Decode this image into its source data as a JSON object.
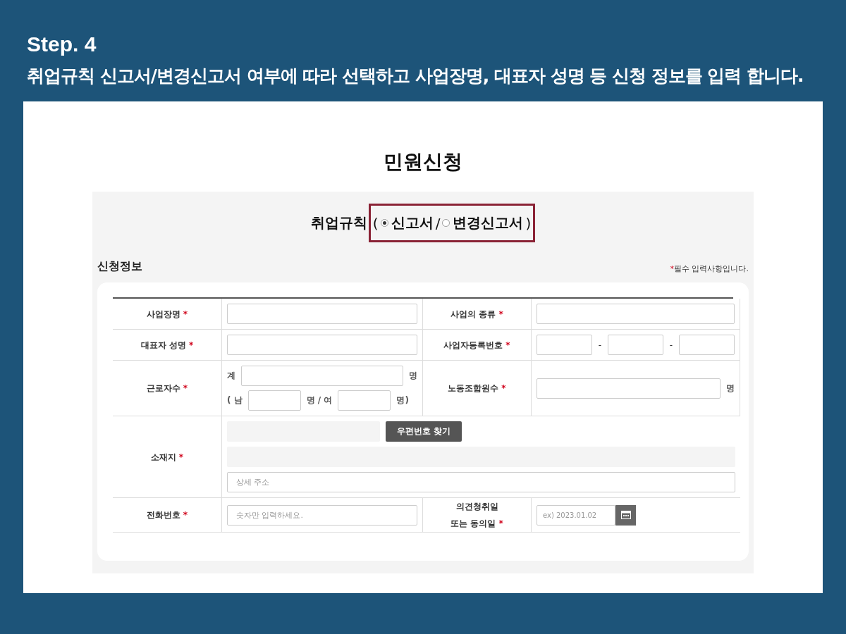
{
  "step": {
    "label": "Step. 4",
    "instruction": "취업규칙 신고서/변경신고서 여부에 따라 선택하고 사업장명, 대표자 성명 등 신청 정보를 입력 합니다."
  },
  "page_title": "민원신청",
  "rule_type": {
    "label": "취업규칙",
    "open": "(",
    "separator": "/",
    "close": ")",
    "options": [
      {
        "label": "신고서",
        "selected": true
      },
      {
        "label": "변경신고서",
        "selected": false
      }
    ]
  },
  "section": {
    "title": "신청정보",
    "note_mark": "*",
    "note": "필수 입력사항입니다."
  },
  "rows": [
    {
      "cells": [
        {
          "kind": "text",
          "label": [
            "사업장명"
          ],
          "required_mark": "*"
        },
        {
          "kind": "text",
          "label": [
            "사업의 종류"
          ],
          "required_mark": "*"
        }
      ]
    },
    {
      "cells": [
        {
          "kind": "text",
          "label": [
            "대표자 성명"
          ],
          "required_mark": "*"
        },
        {
          "kind": "split",
          "label": [
            "사업자등록번호"
          ],
          "required_mark": "*",
          "separators": [
            "-",
            "-"
          ]
        }
      ]
    },
    {
      "cells": [
        {
          "kind": "workers",
          "label": [
            "근로자수"
          ],
          "required_mark": "*",
          "total_prefix": "계",
          "total_unit": "명",
          "male_prefix": "( 남",
          "male_unit": "명 / 여",
          "female_unit": "명)"
        },
        {
          "kind": "unit",
          "label": [
            "노동조합원수"
          ],
          "required_mark": "*",
          "unit": "명"
        }
      ]
    },
    {
      "cells": [
        {
          "kind": "address",
          "label": [
            "소재지"
          ],
          "required_mark": "*",
          "button": "우편번호 찾기",
          "placeholder": "상세 주소"
        }
      ]
    },
    {
      "cells": [
        {
          "kind": "text",
          "label": [
            "전화번호"
          ],
          "required_mark": "*",
          "placeholder": "숫자만 입력하세요."
        },
        {
          "kind": "date",
          "label": [
            "의견청취일",
            "또는 동의일"
          ],
          "required_mark": "*",
          "placeholder": "ex) 2023.01.02"
        }
      ]
    }
  ]
}
